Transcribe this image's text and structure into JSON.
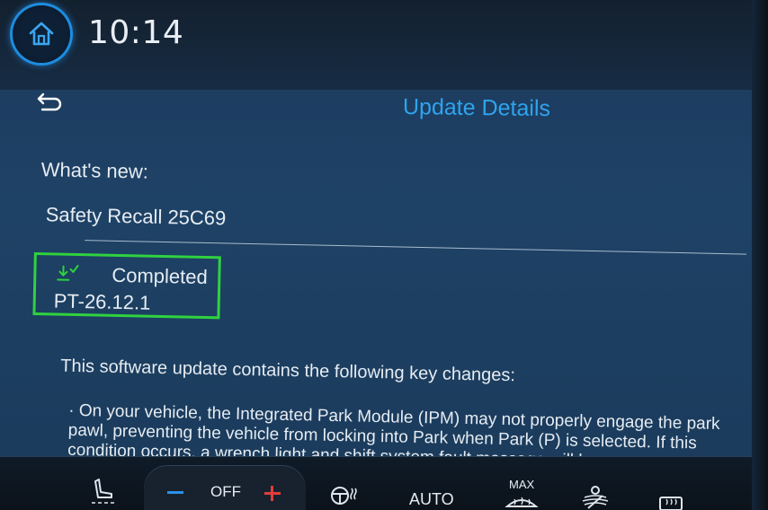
{
  "status_bar": {
    "home_icon": "home-icon",
    "time": "10:14"
  },
  "header": {
    "back_icon": "back-arrow-icon",
    "title": "Update Details"
  },
  "details": {
    "whats_new_label": "What's new:",
    "update_name": "Safety Recall 25C69",
    "status_icon": "download-complete-icon",
    "status": "Completed",
    "version": "PT-26.12.1",
    "intro": "This software update contains the following key changes:",
    "bullet": "· On your vehicle, the Integrated Park Module (IPM) may not properly engage the park pawl, preventing the vehicle from locking into Park when Park (P) is selected. If this condition occurs, a wrench light and shift system fault message will be"
  },
  "climate_bar": {
    "seat_icon": "seat-heat-icon",
    "temp_decrease_icon": "minus-icon",
    "temp_label": "OFF",
    "temp_increase_icon": "plus-icon",
    "steering_heat_icon": "steering-wheel-heat-icon",
    "auto_label": "AUTO",
    "max_label": "MAX",
    "max_defrost_icon": "max-defrost-icon",
    "fan_icon": "fan-icon",
    "rear_defrost_icon": "rear-defrost-icon"
  },
  "colors": {
    "accent_blue": "#2fa3ee",
    "highlight_green": "#2fd23f",
    "background": "#1e4266"
  }
}
